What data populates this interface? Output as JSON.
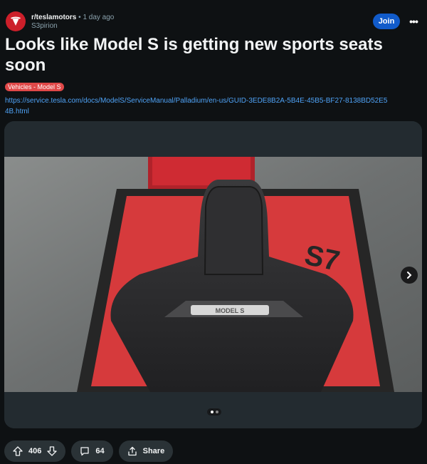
{
  "post": {
    "subreddit": "r/teslamotors",
    "separator": "•",
    "time": "1 day ago",
    "author": "S3pirion",
    "join_label": "Join",
    "more_label": "•••",
    "title": "Looks like Model S is getting new sports seats soon",
    "flair": "Vehicles - Model S",
    "link": "https://service.tesla.com/docs/ModelS/ServiceManual/Palladium/en-us/GUID-3EDE8B2A-5B4E-45B5-BF27-8138BD52E54B.html"
  },
  "gallery": {
    "image_alt": "Black sport seat backrest with illuminated Model S lettering on a red mat",
    "seat_lettering": "MODEL S",
    "current": 1,
    "total": 2
  },
  "actions": {
    "upvotes": "406",
    "comments": "64",
    "share_label": "Share"
  },
  "icons": {
    "subreddit_avatar": "tesla-logo-icon",
    "next": "chevron-right-icon",
    "upvote": "arrow-up-icon",
    "downvote": "arrow-down-icon",
    "comment": "comment-icon",
    "share": "share-icon"
  },
  "colors": {
    "background": "#0e1113",
    "join": "#115bca",
    "flair": "#e04848",
    "link": "#4fa3f7",
    "avatar": "#cc1f2a"
  }
}
